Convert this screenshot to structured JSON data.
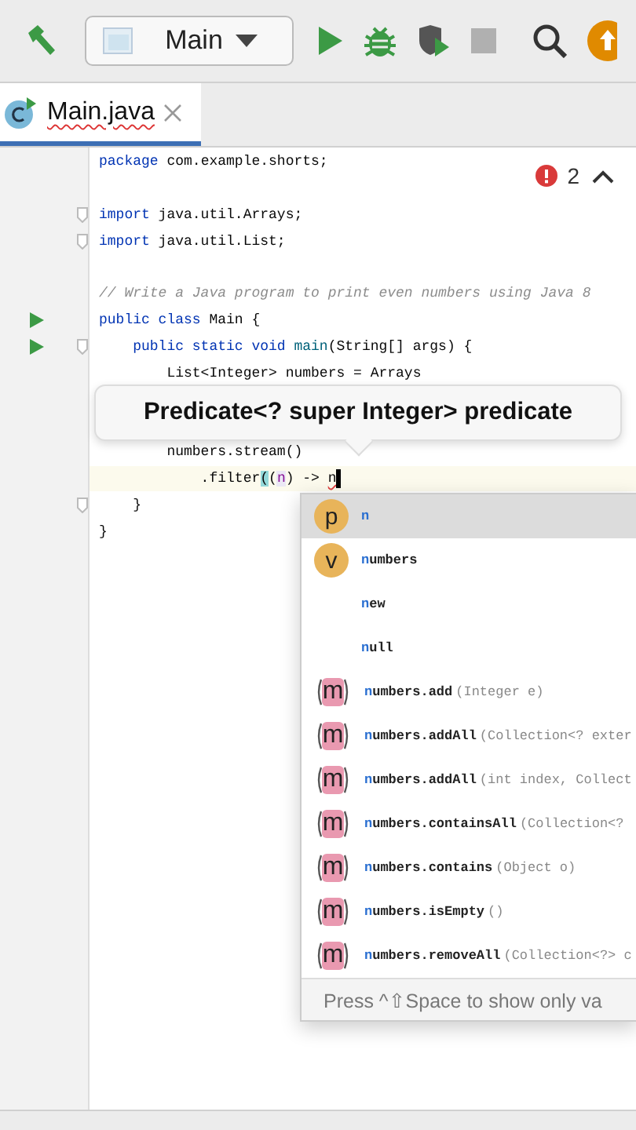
{
  "toolbar": {
    "run_config": "Main",
    "stop_disabled": true
  },
  "tabs": [
    {
      "label": "Main.java",
      "selected": true,
      "has_error": true
    }
  ],
  "editor": {
    "problems": {
      "count": "2"
    },
    "lines": [
      {
        "kind": "code",
        "tokens": [
          {
            "text": "package",
            "kind": "keyword"
          },
          {
            "text": " com.example.shorts;",
            "kind": "plain"
          }
        ]
      },
      {
        "kind": "blank"
      },
      {
        "kind": "code",
        "fold": true,
        "tokens": [
          {
            "text": "import",
            "kind": "keyword"
          },
          {
            "text": " java.util.Arrays;",
            "kind": "plain"
          }
        ]
      },
      {
        "kind": "code",
        "fold": true,
        "tokens": [
          {
            "text": "import",
            "kind": "keyword"
          },
          {
            "text": " java.util.List;",
            "kind": "plain"
          }
        ]
      },
      {
        "kind": "blank"
      },
      {
        "kind": "code",
        "tokens": [
          {
            "text": "// Write a Java program to print even numbers using Java 8",
            "kind": "comment"
          }
        ]
      },
      {
        "kind": "code",
        "run": true,
        "tokens": [
          {
            "text": "public class",
            "kind": "keyword"
          },
          {
            "text": " Main {",
            "kind": "plain"
          }
        ]
      },
      {
        "kind": "code",
        "run": true,
        "fold": true,
        "tokens": [
          {
            "text": "    public static void ",
            "kind": "keyword"
          },
          {
            "text": "main",
            "kind": "method"
          },
          {
            "text": "(String[] args) {",
            "kind": "plain"
          }
        ]
      },
      {
        "kind": "code",
        "tokens": [
          {
            "text": "        List<Integer> numbers = Arrays",
            "kind": "plain"
          }
        ]
      },
      {
        "kind": "blank"
      },
      {
        "kind": "blank"
      },
      {
        "kind": "code",
        "tokens": [
          {
            "text": "        numbers.stream()",
            "kind": "plain"
          }
        ]
      },
      {
        "kind": "code",
        "current": true,
        "cursor": true,
        "tokens": [
          {
            "text": "            .filter",
            "kind": "plain"
          },
          {
            "text": "(",
            "kind": "brace"
          },
          {
            "text": "(",
            "kind": "plain"
          },
          {
            "text": "n",
            "kind": "param"
          },
          {
            "text": ") -> ",
            "kind": "plain"
          },
          {
            "text": "n",
            "kind": "error"
          }
        ]
      },
      {
        "kind": "code",
        "fold": true,
        "tokens": [
          {
            "text": "    }",
            "kind": "plain"
          }
        ]
      },
      {
        "kind": "code",
        "tokens": [
          {
            "text": "}",
            "kind": "plain"
          }
        ]
      }
    ]
  },
  "tooltip": {
    "text": "Predicate<? super Integer> predicate"
  },
  "completion": {
    "items": [
      {
        "kind": "parameter",
        "icon": "p",
        "name": "n",
        "selected": true
      },
      {
        "kind": "variable",
        "icon": "v",
        "name": "numbers",
        "selected": false
      },
      {
        "kind": "keyword",
        "name": "new",
        "selected": false
      },
      {
        "kind": "keyword",
        "name": "null",
        "selected": false
      },
      {
        "kind": "method",
        "icon": "m",
        "name": "numbers.add",
        "params": "(Integer e)",
        "selected": false
      },
      {
        "kind": "method",
        "icon": "m",
        "name": "numbers.addAll",
        "params": "(Collection<? exter",
        "selected": false
      },
      {
        "kind": "method",
        "icon": "m",
        "name": "numbers.addAll",
        "params": "(int index, Collect",
        "selected": false
      },
      {
        "kind": "method",
        "icon": "m",
        "name": "numbers.containsAll",
        "params": "(Collection<?",
        "selected": false
      },
      {
        "kind": "method",
        "icon": "m",
        "name": "numbers.contains",
        "params": "(Object o)",
        "selected": false
      },
      {
        "kind": "method",
        "icon": "m",
        "name": "numbers.isEmpty",
        "params": "()",
        "selected": false
      },
      {
        "kind": "method",
        "icon": "m",
        "name": "numbers.removeAll",
        "params": "(Collection<?> c",
        "selected": false
      }
    ],
    "footer": "Press ^⇧Space to show only va"
  }
}
